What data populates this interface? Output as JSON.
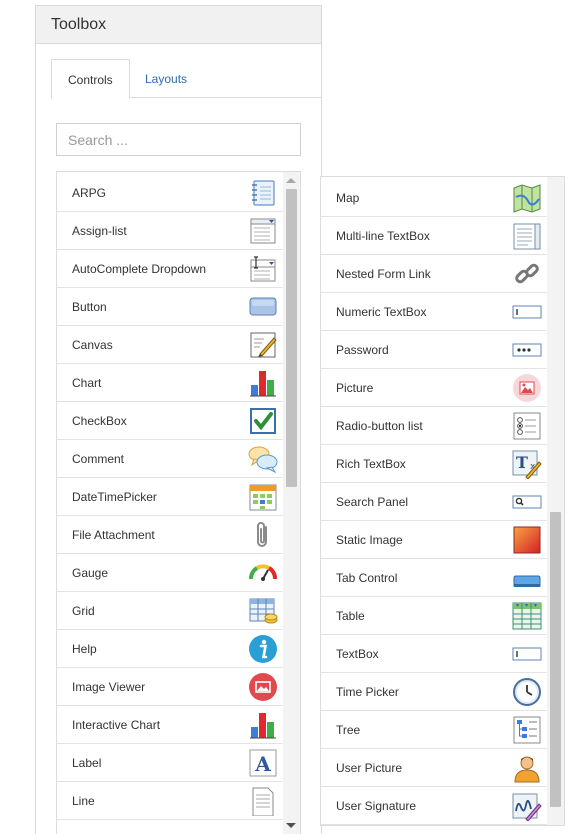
{
  "panel": {
    "title": "Toolbox"
  },
  "tabs": [
    {
      "label": "Controls",
      "active": true
    },
    {
      "label": "Layouts",
      "active": false
    }
  ],
  "search": {
    "placeholder": "Search ...",
    "value": ""
  },
  "left_list": [
    {
      "label": "ARPG",
      "icon": "notebook-icon"
    },
    {
      "label": "Assign-list",
      "icon": "assign-list-icon"
    },
    {
      "label": "AutoComplete Dropdown",
      "icon": "autocomplete-dropdown-icon"
    },
    {
      "label": "Button",
      "icon": "button-icon"
    },
    {
      "label": "Canvas",
      "icon": "canvas-pen-icon"
    },
    {
      "label": "Chart",
      "icon": "bar-chart-icon"
    },
    {
      "label": "CheckBox",
      "icon": "checkbox-icon"
    },
    {
      "label": "Comment",
      "icon": "comment-bubbles-icon"
    },
    {
      "label": "DateTimePicker",
      "icon": "calendar-icon"
    },
    {
      "label": "File Attachment",
      "icon": "paperclip-icon"
    },
    {
      "label": "Gauge",
      "icon": "gauge-icon"
    },
    {
      "label": "Grid",
      "icon": "grid-coins-icon"
    },
    {
      "label": "Help",
      "icon": "info-icon"
    },
    {
      "label": "Image Viewer",
      "icon": "image-viewer-icon"
    },
    {
      "label": "Interactive Chart",
      "icon": "interactive-chart-icon"
    },
    {
      "label": "Label",
      "icon": "label-a-icon"
    },
    {
      "label": "Line",
      "icon": "line-document-icon"
    }
  ],
  "right_list": [
    {
      "label": "Map",
      "icon": "map-icon"
    },
    {
      "label": "Multi-line TextBox",
      "icon": "multiline-textbox-icon"
    },
    {
      "label": "Nested Form Link",
      "icon": "chain-link-icon"
    },
    {
      "label": "Numeric TextBox",
      "icon": "numeric-textbox-icon"
    },
    {
      "label": "Password",
      "icon": "password-icon"
    },
    {
      "label": "Picture",
      "icon": "picture-icon"
    },
    {
      "label": "Radio-button list",
      "icon": "radio-list-icon"
    },
    {
      "label": "Rich TextBox",
      "icon": "rich-textbox-icon"
    },
    {
      "label": "Search Panel",
      "icon": "search-panel-icon"
    },
    {
      "label": "Static Image",
      "icon": "static-image-icon"
    },
    {
      "label": "Tab Control",
      "icon": "tab-control-icon"
    },
    {
      "label": "Table",
      "icon": "table-icon"
    },
    {
      "label": "TextBox",
      "icon": "textbox-icon"
    },
    {
      "label": "Time Picker",
      "icon": "clock-icon"
    },
    {
      "label": "Tree",
      "icon": "tree-icon"
    },
    {
      "label": "User Picture",
      "icon": "user-icon"
    },
    {
      "label": "User Signature",
      "icon": "signature-icon"
    }
  ],
  "colors": {
    "link": "#2a6db0",
    "border": "#dcdcdc",
    "header_bg": "#f1f1f1"
  }
}
